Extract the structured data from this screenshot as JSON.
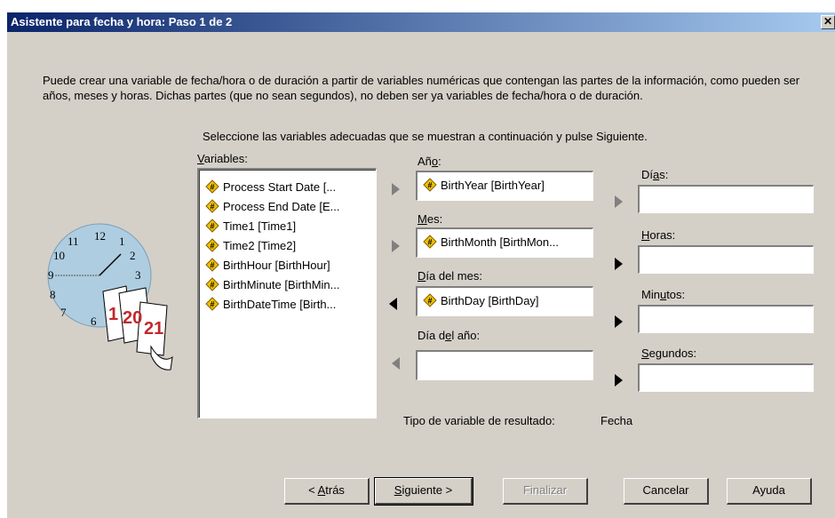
{
  "window": {
    "title": "Asistente para fecha y hora: Paso 1 de 2",
    "close_label": "✕"
  },
  "intro_text": "Puede crear una variable de fecha/hora o de duración a partir de variables numéricas que contengan las partes de la información, como pueden ser años, meses y horas. Dichas partes (que no sean segundos), no deben ser ya variables de fecha/hora o de duración.",
  "instruction_text": "Seleccione las variables adecuadas que se muestran a continuación y pulse Siguiente.",
  "variables": {
    "label_pre": "",
    "label_key": "V",
    "label_post": "ariables:",
    "items": [
      "Process Start Date [...",
      "Process End Date [E...",
      "Time1 [Time1]",
      "Time2 [Time2]",
      "BirthHour [BirthHour]",
      "BirthMinute [BirthMin...",
      "BirthDateTime [Birth..."
    ]
  },
  "fields": {
    "anio": {
      "label_pre": "Añ",
      "label_key": "o",
      "label_post": ":",
      "value": "BirthYear [BirthYear]"
    },
    "mes": {
      "label_pre": "",
      "label_key": "M",
      "label_post": "es:",
      "value": "BirthMonth [BirthMon..."
    },
    "dia_mes": {
      "label_pre": "",
      "label_key": "D",
      "label_post": "ía del mes:",
      "value": "BirthDay [BirthDay]"
    },
    "dia_anio": {
      "label_pre": "Día d",
      "label_key": "e",
      "label_post": "l año:",
      "value": ""
    },
    "dias": {
      "label_pre": "Dí",
      "label_key": "a",
      "label_post": "s:",
      "value": ""
    },
    "horas": {
      "label_pre": "",
      "label_key": "H",
      "label_post": "oras:",
      "value": ""
    },
    "minutos": {
      "label_pre": "Min",
      "label_key": "u",
      "label_post": "tos:",
      "value": ""
    },
    "segundos": {
      "label_pre": "",
      "label_key": "S",
      "label_post": "egundos:",
      "value": ""
    }
  },
  "result": {
    "label": "Tipo de variable de resultado:",
    "value": "Fecha"
  },
  "buttons": {
    "back": {
      "pre": "< ",
      "key": "A",
      "post": "trás"
    },
    "next": {
      "pre": "",
      "key": "S",
      "post": "iguiente >"
    },
    "finish": {
      "label": "Finalizar"
    },
    "cancel": {
      "label": "Cancelar"
    },
    "help": {
      "label": "Ayuda"
    }
  },
  "illustration": {
    "clock_numbers": [
      "12",
      "1",
      "2",
      "3",
      "7",
      "8",
      "9",
      "10",
      "11",
      "6"
    ],
    "calendar_numbers": [
      "1",
      "20",
      "21"
    ]
  },
  "colors": {
    "title_start": "#0a246a",
    "title_end": "#a6caf0",
    "dialog_bg": "#d4d0c8",
    "arrow_active": "#000000",
    "arrow_disabled": "#808080",
    "clock_face": "#aecde0"
  }
}
